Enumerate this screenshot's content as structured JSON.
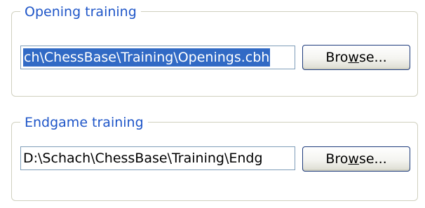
{
  "opening": {
    "legend": "Opening training",
    "path_value": "ch\\ChessBase\\Training\\Openings.cbh",
    "browse": {
      "before": "Bro",
      "accel": "w",
      "after": "se..."
    }
  },
  "endgame": {
    "legend": "Endgame training",
    "path_value": "D:\\Schach\\ChessBase\\Training\\Endg",
    "browse": {
      "before": "Bro",
      "accel": "w",
      "after": "se..."
    }
  },
  "colors": {
    "legend_text": "#1e55c8",
    "selection": "#316ac5",
    "field_border": "#7f9db9",
    "group_border": "#d0d0bf"
  }
}
